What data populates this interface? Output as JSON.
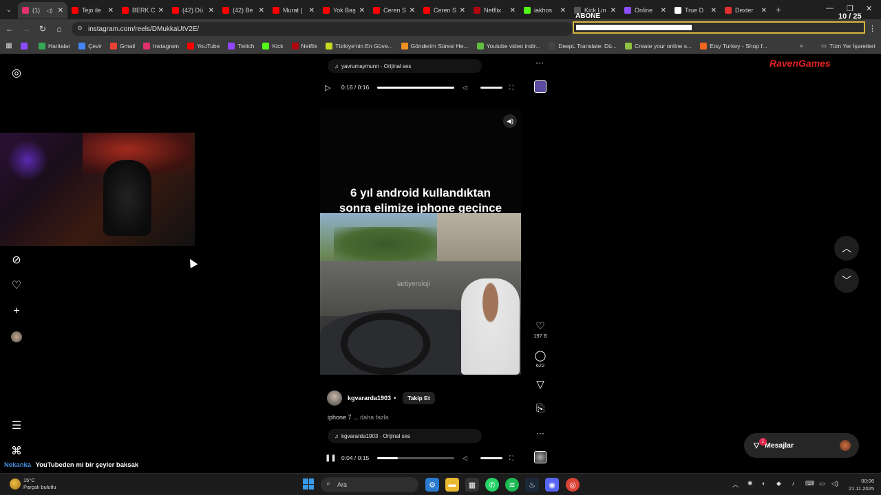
{
  "browser": {
    "tabs": [
      {
        "label": "(1)",
        "color": "#e1306c",
        "active": true
      },
      {
        "label": "Tejo ile",
        "color": "#ff0000"
      },
      {
        "label": "BERK C",
        "color": "#ff0000"
      },
      {
        "label": "(42) Dü",
        "color": "#ff0000"
      },
      {
        "label": "(42) Be",
        "color": "#ff0000"
      },
      {
        "label": "Murat (",
        "color": "#ff0000"
      },
      {
        "label": "Yok Baş",
        "color": "#ff0000"
      },
      {
        "label": "Ceren S",
        "color": "#ff0000"
      },
      {
        "label": "Ceren S",
        "color": "#ff0000"
      },
      {
        "label": "Netflix",
        "color": "#b00710"
      },
      {
        "label": "iakhos",
        "color": "#53fc18"
      },
      {
        "label": "Kick Lin",
        "color": "#555555"
      },
      {
        "label": "Online",
        "color": "#8a4dff"
      },
      {
        "label": "True D",
        "color": "#ffffff"
      },
      {
        "label": "Dexter",
        "color": "#e03030"
      }
    ],
    "url": "instagram.com/reels/DMukkaUtV2E/",
    "bookmarks": [
      {
        "label": "",
        "color": "#8a4dff"
      },
      {
        "label": "Haritalar",
        "color": "#34a853"
      },
      {
        "label": "Çevir",
        "color": "#4285f4"
      },
      {
        "label": "Gmail",
        "color": "#ea4335"
      },
      {
        "label": "Instagram",
        "color": "#e1306c"
      },
      {
        "label": "YouTube",
        "color": "#ff0000"
      },
      {
        "label": "Twitch",
        "color": "#9146ff"
      },
      {
        "label": "Kick",
        "color": "#53fc18"
      },
      {
        "label": "Netflix",
        "color": "#b00710"
      },
      {
        "label": "Türkiye'nin En Güve...",
        "color": "#c8d820"
      },
      {
        "label": "Gönderim Süresi He...",
        "color": "#f09020"
      },
      {
        "label": "Youtube video indir...",
        "color": "#60c040"
      },
      {
        "label": "DeepL Translate: Dü...",
        "color": "#444444"
      },
      {
        "label": "Create your online s...",
        "color": "#90c040"
      },
      {
        "label": "Etsy Turkey - Shop f...",
        "color": "#f16521"
      }
    ],
    "all_bookmarks": "Tüm Yer İşaretleri"
  },
  "stream_overlay": {
    "abone_label": "ABONE",
    "counter": "10 / 25",
    "progress": 0.4,
    "logo_text": "RavenGames"
  },
  "reel_prev": {
    "audio": "yavrumaymunn · Orijinal ses",
    "time": "0:16 / 0:16",
    "progress": 1.0
  },
  "reel": {
    "caption_line1": "6 yıl android kullandıktan",
    "caption_line2": "sonra elimize iphone geçince",
    "watermark": "iartiyeroloji",
    "username": "kgvararda1903",
    "dot": "•",
    "follow_label": "Takip Et",
    "description": "iphone 7 ...",
    "more_label": "daha fazla",
    "audio": "kgvararda1903 · Orijinal ses",
    "time": "0:04 / 0:15",
    "progress": 0.27
  },
  "actions": {
    "likes": "197 B",
    "comments": "622"
  },
  "messages": {
    "label": "Mesajlar",
    "badge": "1"
  },
  "chat": {
    "name": "Nekanka",
    "text": "YouTubeden mi bir şeyler baksak"
  },
  "taskbar": {
    "temp": "15°C",
    "weather": "Parçalı bulutlu",
    "search_placeholder": "Ara",
    "time": "00:06",
    "date": "21.11.2025"
  }
}
